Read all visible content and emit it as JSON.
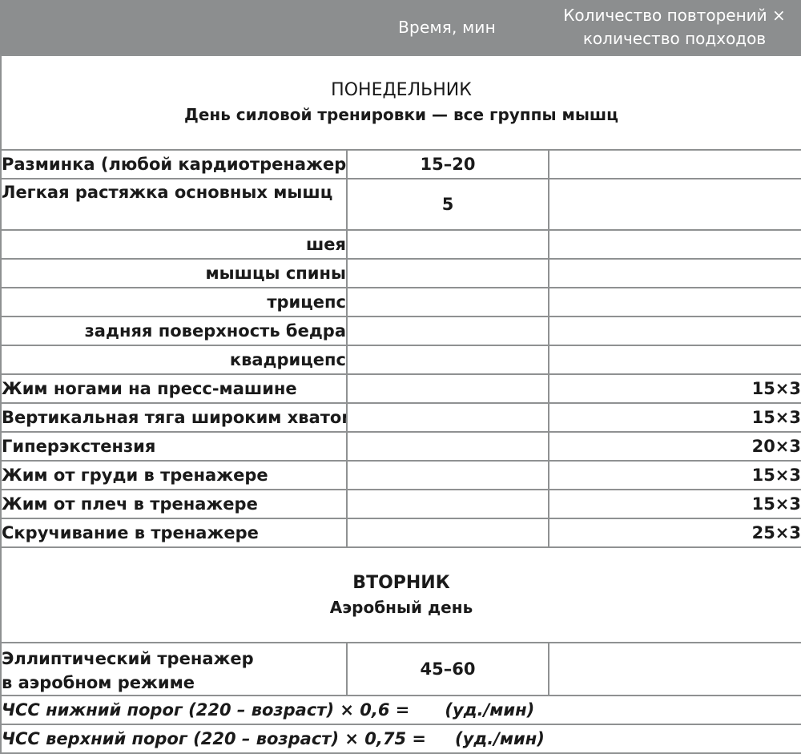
{
  "header": {
    "col_time": "Время, мин",
    "col_reps_line1": "Количество повторений ×",
    "col_reps_line2": "количество подходов"
  },
  "monday": {
    "name": "ПОНЕДЕЛЬНИК",
    "subtitle": "День силовой тренировки — все группы мышц",
    "warmup": {
      "label": "Разминка (любой кардиотренажер)",
      "time": "15–20"
    },
    "stretch": {
      "label": "Легкая растяжка основных мышц",
      "time": "5"
    },
    "muscles": [
      "шея",
      "мышцы спины",
      "трицепс",
      "задняя поверхность бедра",
      "квадрицепс"
    ],
    "exercises": [
      {
        "label": "Жим ногами на пресс-машине",
        "reps": "15×3"
      },
      {
        "label": "Вертикальная тяга широким хватом",
        "reps": "15×3"
      },
      {
        "label": "Гиперэкстензия",
        "reps": "20×3"
      },
      {
        "label": "Жим от груди в тренажере",
        "reps": "15×3"
      },
      {
        "label": "Жим от плеч в тренажере",
        "reps": "15×3"
      },
      {
        "label": "Скручивание в тренажере",
        "reps": "25×3"
      }
    ]
  },
  "tuesday": {
    "name": "ВТОРНИК",
    "subtitle": "Аэробный день",
    "elliptical": {
      "line1": "Эллиптический тренажер",
      "line2": "в аэробном режиме",
      "time": "45–60"
    },
    "hr_low": {
      "text": "ЧСС нижний порог (220 – возраст) × 0,6 =",
      "unit": "(уд./мин)"
    },
    "hr_high": {
      "text": "ЧСС верхний порог (220 – возраст) × 0,75 =",
      "unit": "(уд./мин)"
    }
  }
}
